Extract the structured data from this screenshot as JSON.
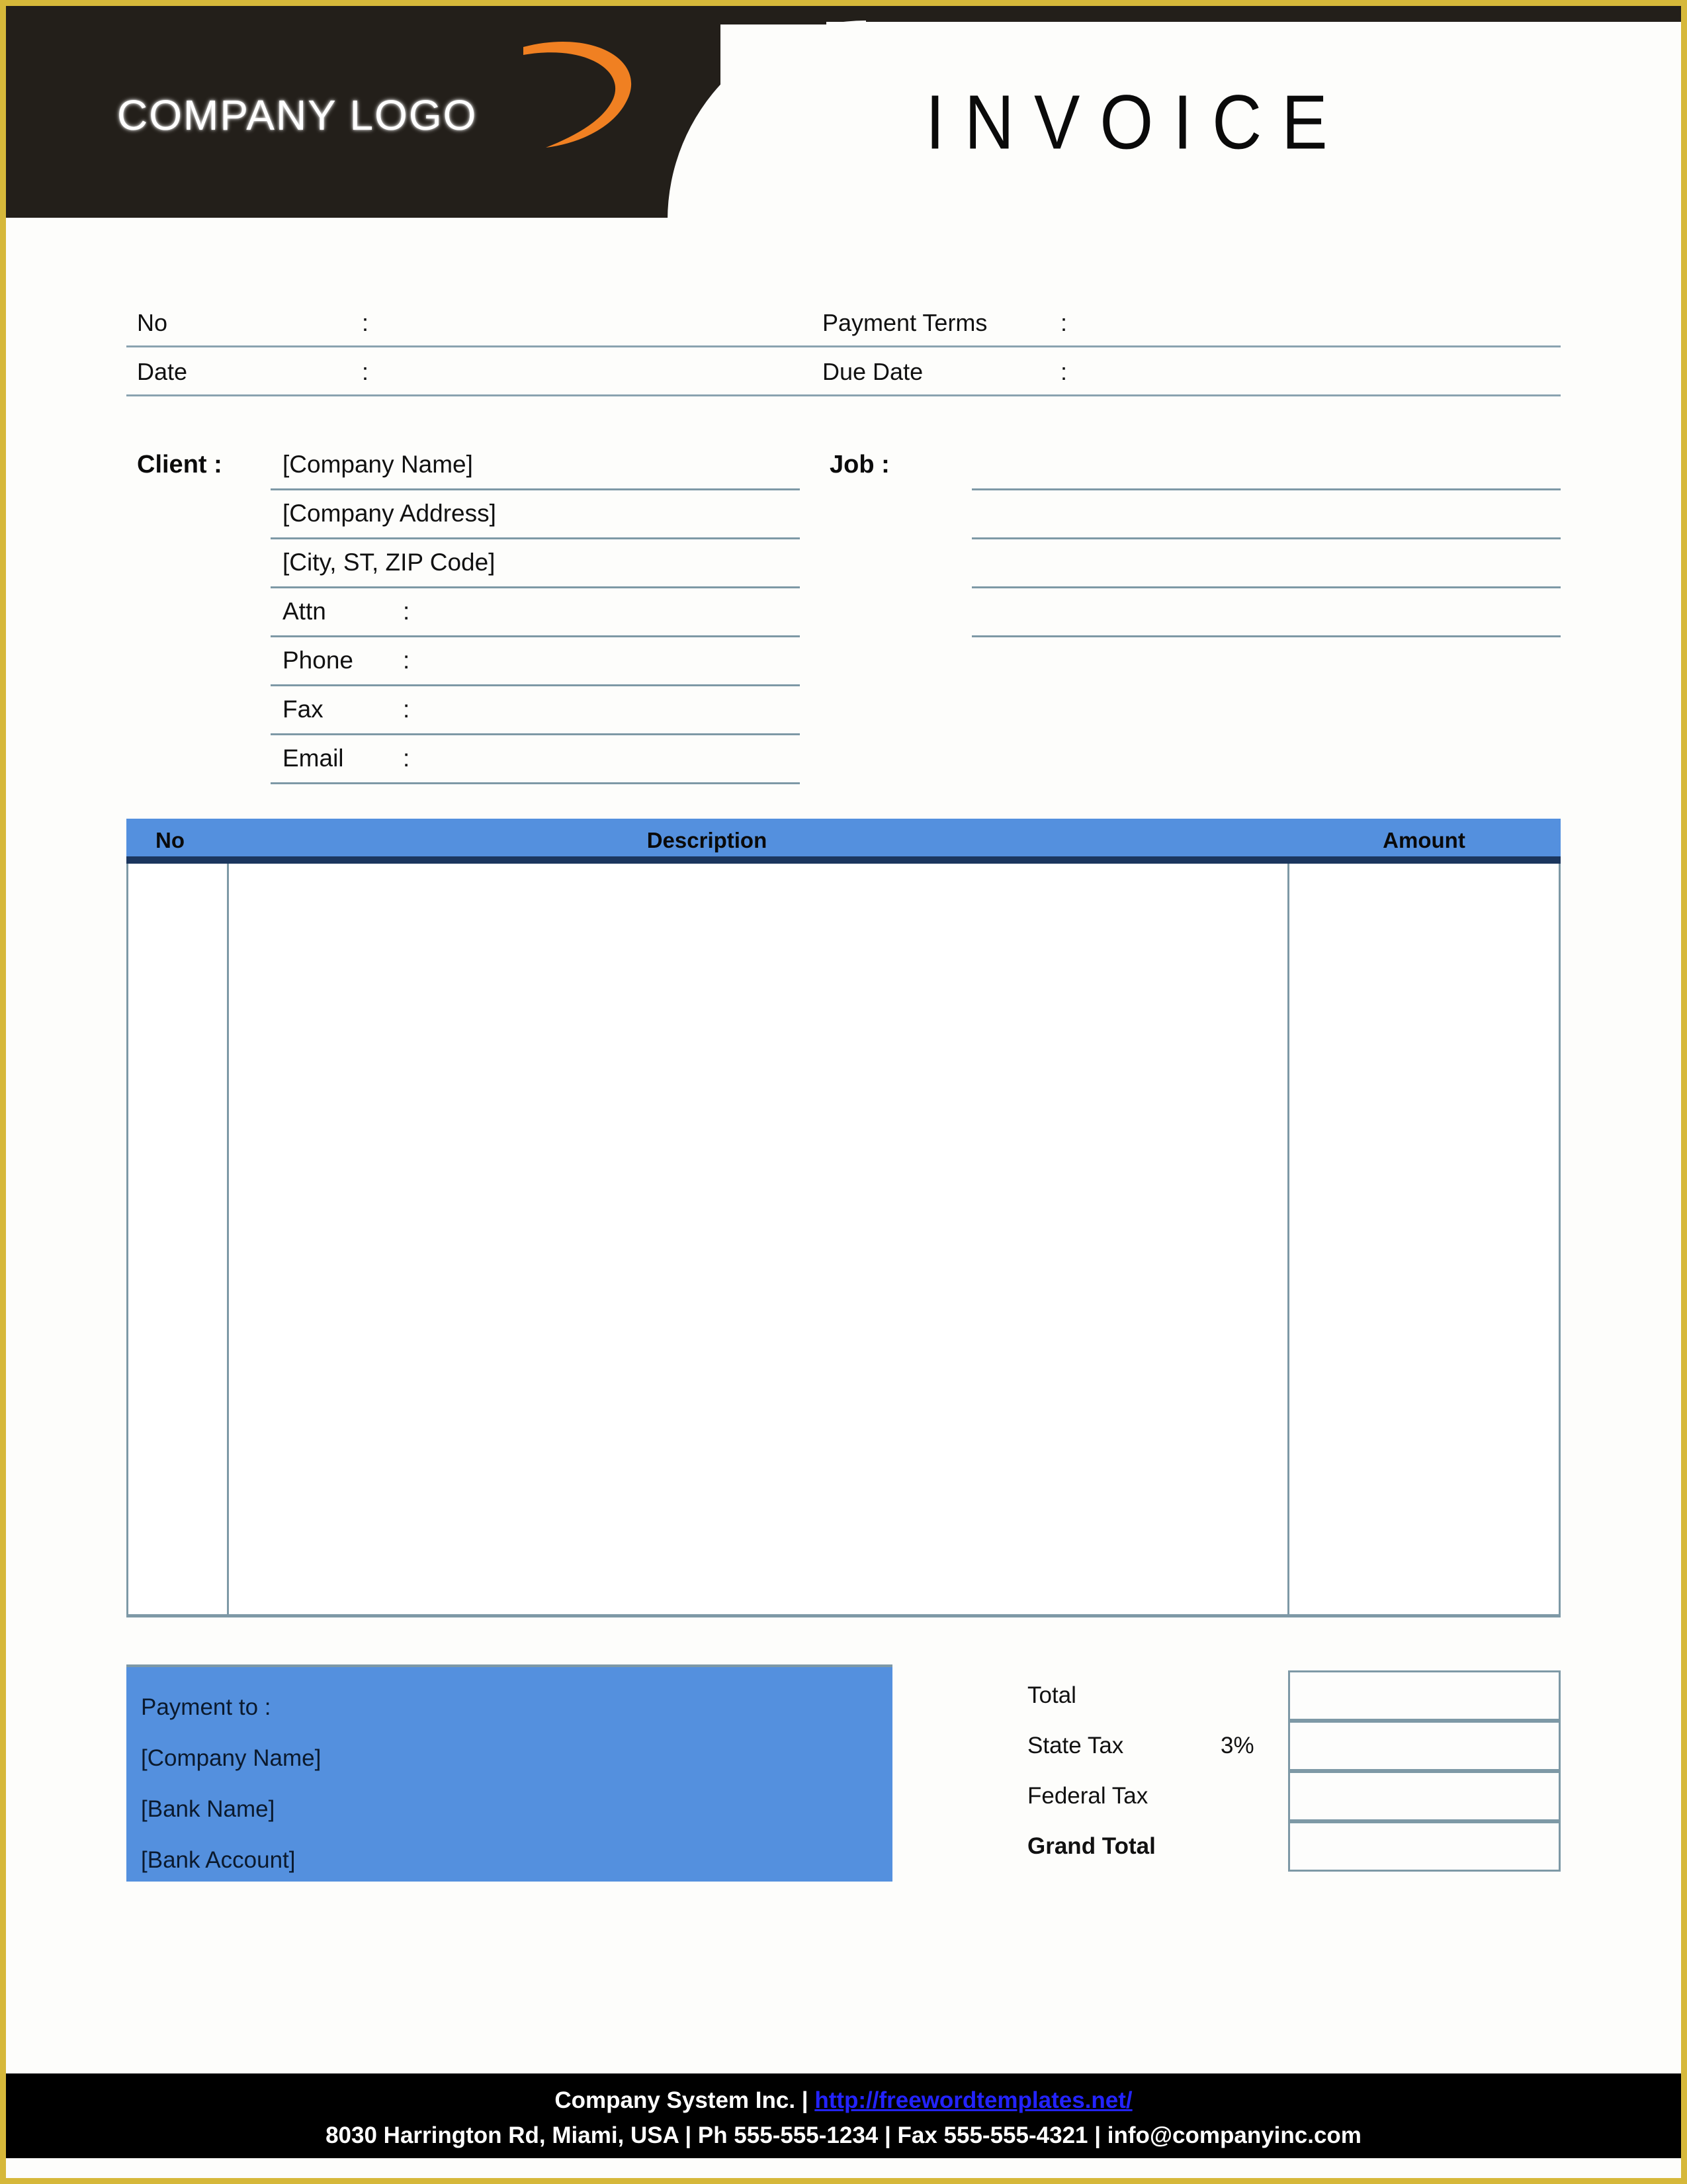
{
  "page": {
    "accent_blue": "#5490de",
    "border_gold": "#d6b83a",
    "header_dark": "#231f1a",
    "rule_blue_gray": "#7e99a6",
    "header_underline_navy": "#1b365e",
    "link_blue": "#2323ff"
  },
  "header": {
    "logo_text": "COMPANY LOGO",
    "logo_swoosh_color": "#f08022",
    "title": "INVOICE"
  },
  "meta": {
    "rows": [
      {
        "left_label": "No",
        "left_colon": ":",
        "right_label": "Payment  Terms",
        "right_colon": ":"
      },
      {
        "left_label": "Date",
        "left_colon": ":",
        "right_label": "Due Date",
        "right_colon": ":"
      }
    ]
  },
  "client": {
    "label": "Client  :",
    "lines": [
      {
        "type": "value",
        "text": "[Company Name]"
      },
      {
        "type": "value",
        "text": "[Company Address]"
      },
      {
        "type": "value",
        "text": "[City, ST, ZIP Code]"
      },
      {
        "type": "field",
        "label": "Attn",
        "colon": ":",
        "value": ""
      },
      {
        "type": "field",
        "label": "Phone",
        "colon": ":",
        "value": ""
      },
      {
        "type": "field",
        "label": "Fax",
        "colon": ":",
        "value": ""
      },
      {
        "type": "field",
        "label": "Email",
        "colon": ":",
        "value": ""
      }
    ]
  },
  "job": {
    "label": "Job  :",
    "lines": [
      "",
      "",
      "",
      ""
    ]
  },
  "items": {
    "columns": [
      "No",
      "Description",
      "Amount"
    ],
    "rows": []
  },
  "payment": {
    "lines": [
      "Payment to :",
      "[Company Name]",
      "[Bank Name]",
      "[Bank Account]"
    ]
  },
  "totals": {
    "rows": [
      {
        "label": "Total",
        "pct": "",
        "value": "",
        "bold": false
      },
      {
        "label": "State Tax",
        "pct": "3%",
        "value": "",
        "bold": false
      },
      {
        "label": "Federal Tax",
        "pct": "",
        "value": "",
        "bold": false
      },
      {
        "label": "Grand Total",
        "pct": "",
        "value": "",
        "bold": true
      }
    ]
  },
  "footer": {
    "line1_prefix": "Company System Inc. | ",
    "line1_url": "http://freewordtemplates.net/",
    "line2": "8030 Harrington Rd, Miami, USA | Ph 555-555-1234 | Fax 555-555-4321 | info@companyinc.com"
  }
}
